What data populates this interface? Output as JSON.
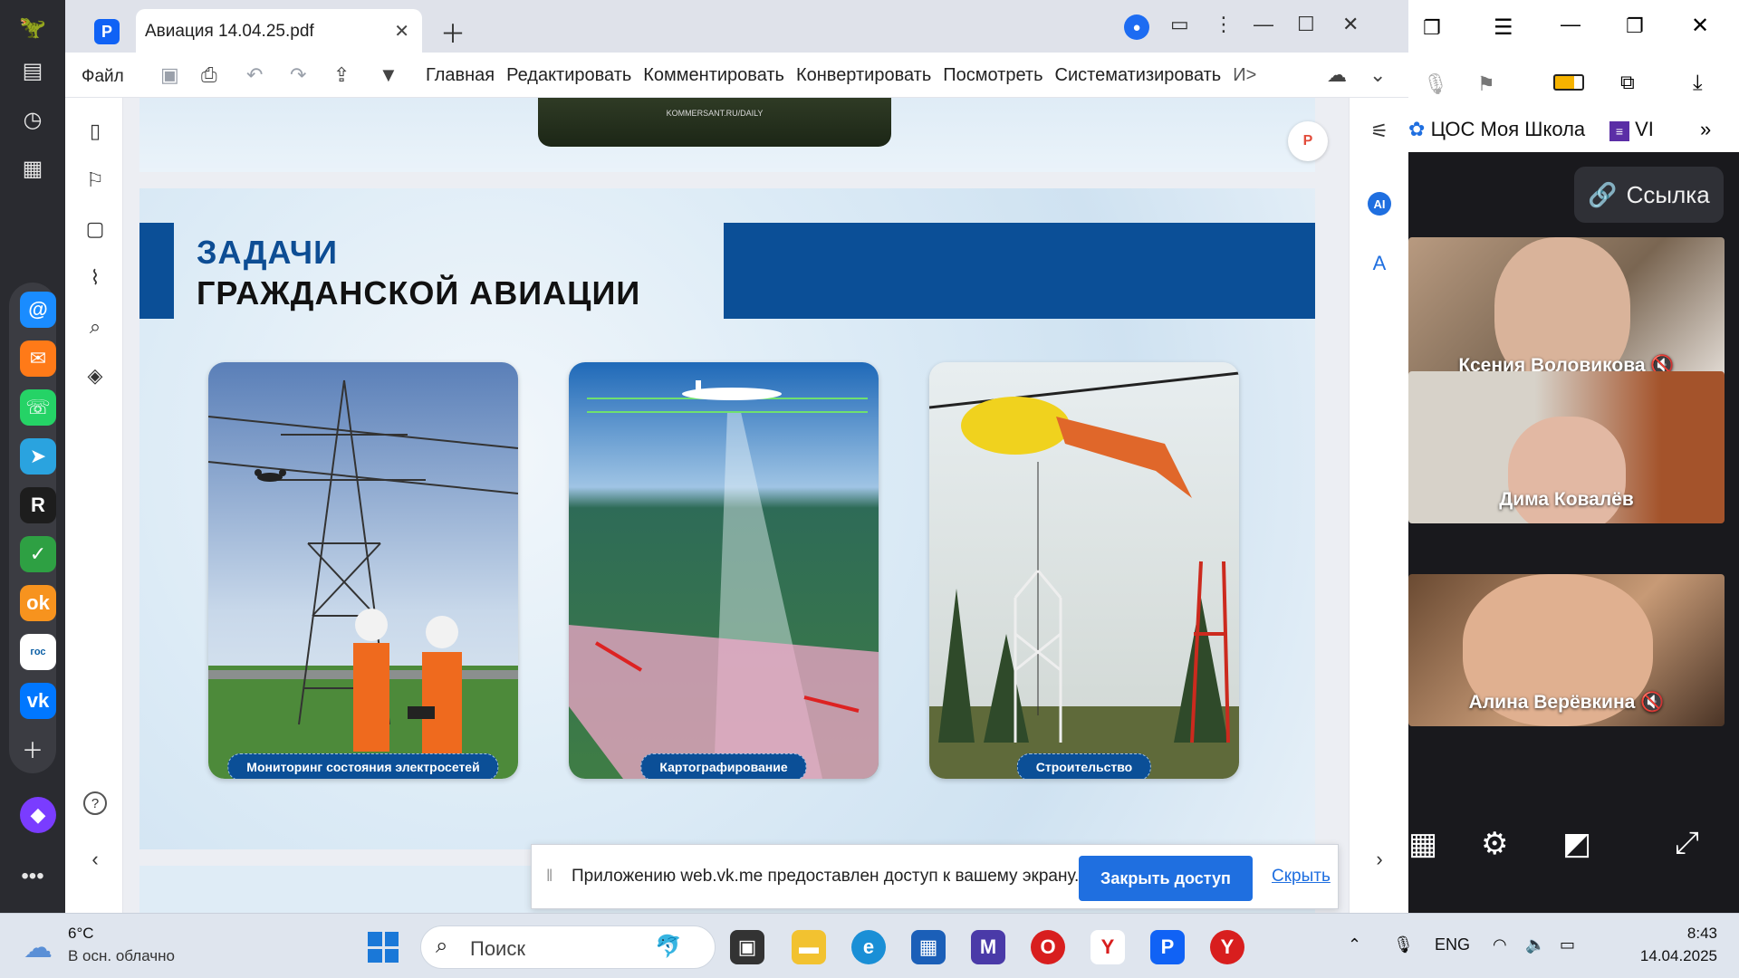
{
  "window": {
    "tab_title": "Авиация 14.04.25.pdf",
    "menu_file": "Файл",
    "menu": [
      "Главная",
      "Редактировать",
      "Комментировать",
      "Конвертировать",
      "Посмотреть",
      "Систематизировать"
    ],
    "more_chevron": "И>"
  },
  "slide": {
    "title_line1": "ЗАДАЧИ",
    "title_line2": "ГРАЖДАНСКОЙ АВИАЦИИ",
    "cards": [
      {
        "label": "Мониторинг состояния электросетей"
      },
      {
        "label": "Картографирование"
      },
      {
        "label": "Строительство"
      }
    ],
    "prev_page_caption": "KOMMERSANT.RU/DAILY"
  },
  "share_bar": {
    "message": "Приложению web.vk.me предоставлен доступ к вашему экрану.",
    "stop_label": "Закрыть доступ",
    "hide_label": "Скрыть"
  },
  "call": {
    "bookmark_label": "ЦОС Моя Школа",
    "bookmark2_label": "VI",
    "link_label": "Ссылка",
    "participants": [
      {
        "name": "Ксения Воловикова",
        "muted": true
      },
      {
        "name": "Дима Ковалёв",
        "muted": false
      },
      {
        "name": "Алина Верёвкина",
        "muted": true
      }
    ]
  },
  "taskbar": {
    "weather_temp": "6°C",
    "weather_desc": "В осн. облачно",
    "search_placeholder": "Поиск",
    "lang": "ENG",
    "time": "8:43",
    "date": "14.04.2025"
  },
  "right_rail": {
    "ai_label": "AI"
  }
}
